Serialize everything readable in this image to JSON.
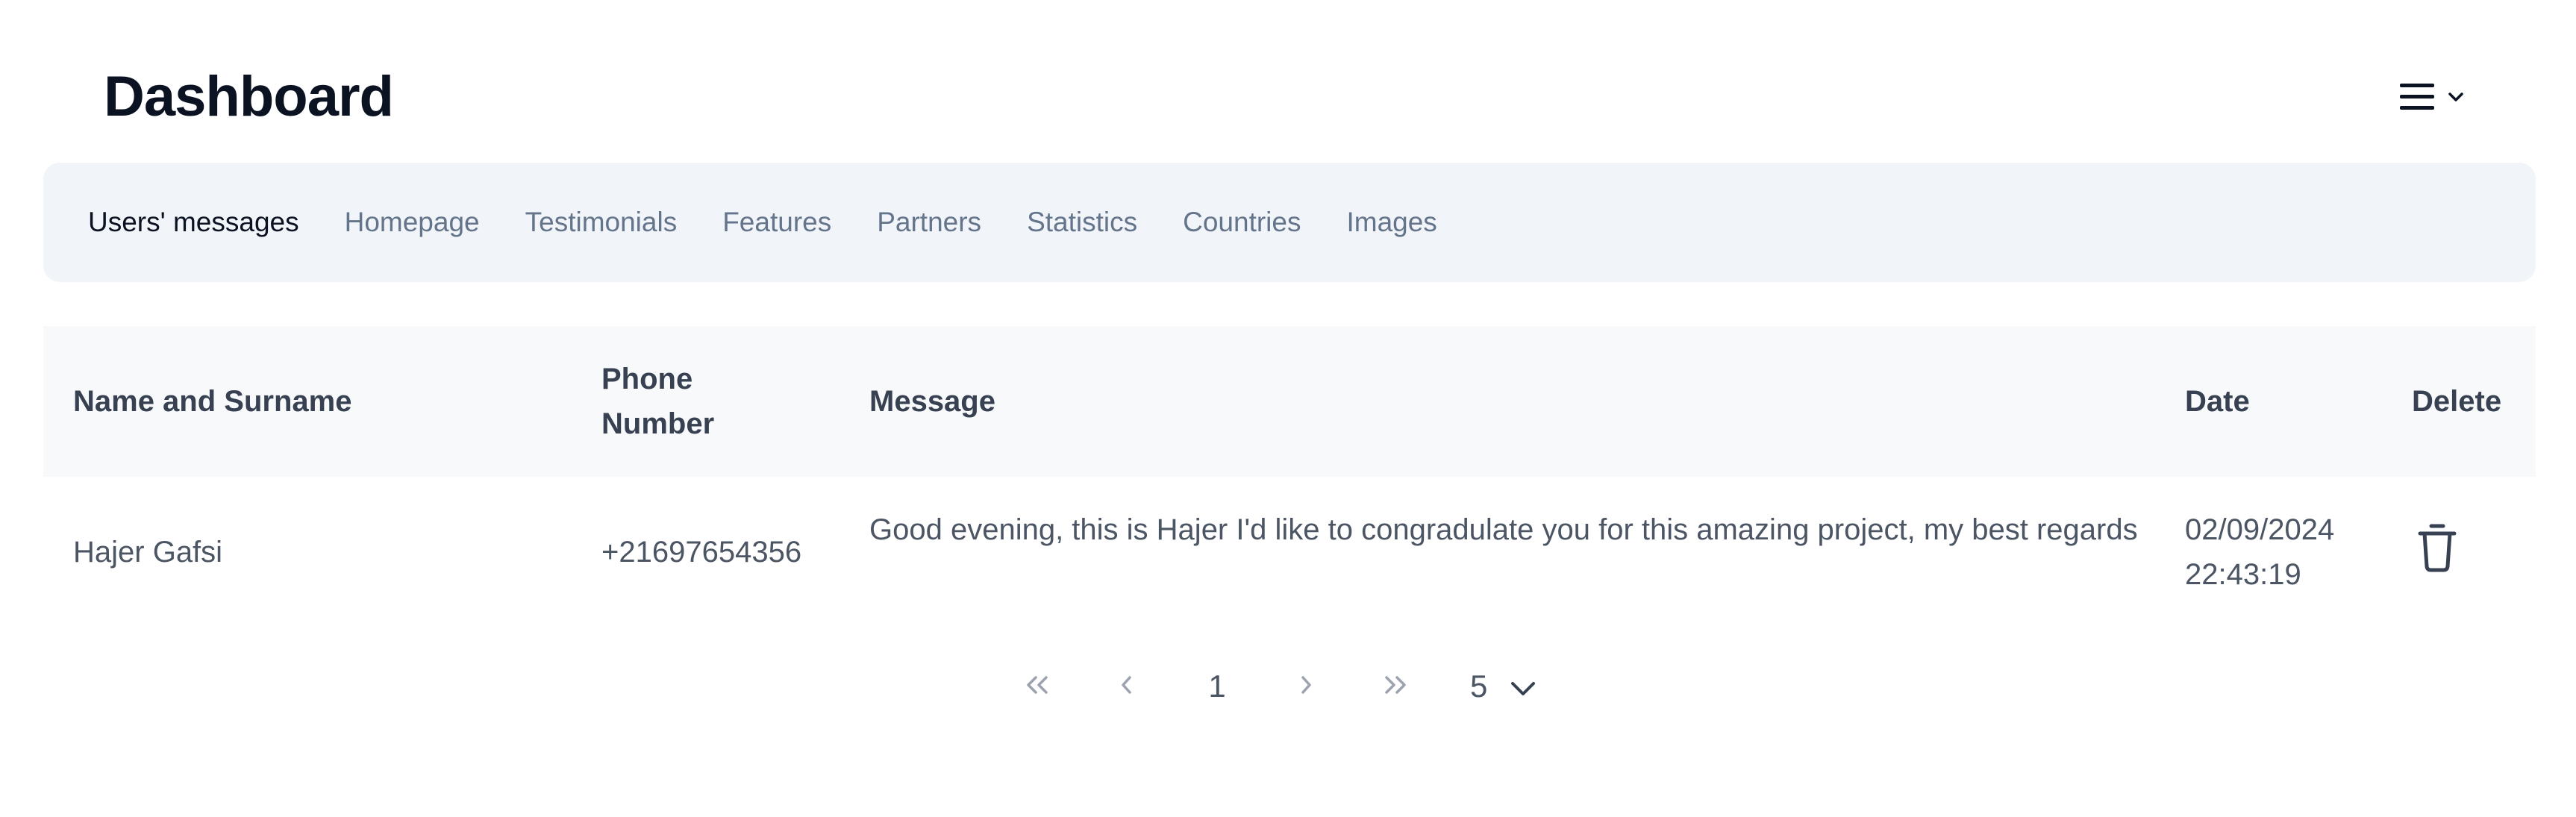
{
  "header": {
    "title": "Dashboard",
    "menu_icon": "hamburger-menu-icon"
  },
  "tabs": [
    {
      "label": "Users' messages",
      "active": true
    },
    {
      "label": "Homepage",
      "active": false
    },
    {
      "label": "Testimonials",
      "active": false
    },
    {
      "label": "Features",
      "active": false
    },
    {
      "label": "Partners",
      "active": false
    },
    {
      "label": "Statistics",
      "active": false
    },
    {
      "label": "Countries",
      "active": false
    },
    {
      "label": "Images",
      "active": false
    }
  ],
  "table": {
    "columns": {
      "name": "Name and Surname",
      "phone_line1": "Phone",
      "phone_line2": "Number",
      "message": "Message",
      "date": "Date",
      "delete": "Delete"
    },
    "rows": [
      {
        "name": "Hajer Gafsi",
        "phone": "+21697654356",
        "message": "Good evening, this is Hajer I'd like to congradulate you for this amazing project, my best regards",
        "date_line1": "02/09/2024",
        "date_line2": "22:43:19",
        "delete_icon": "trash-icon"
      }
    ]
  },
  "pagination": {
    "current_page": "1",
    "page_size": "5",
    "icons": {
      "first": "double-chevron-left-icon",
      "prev": "chevron-left-icon",
      "next": "chevron-right-icon",
      "last": "double-chevron-right-icon",
      "size_dropdown": "chevron-down-icon"
    }
  },
  "colors": {
    "title": "#0b1222",
    "tab_active": "#0b1222",
    "tab_inactive": "#64748b",
    "tabs_bg": "#f1f4f8",
    "thead_bg": "#f8f9fb"
  }
}
